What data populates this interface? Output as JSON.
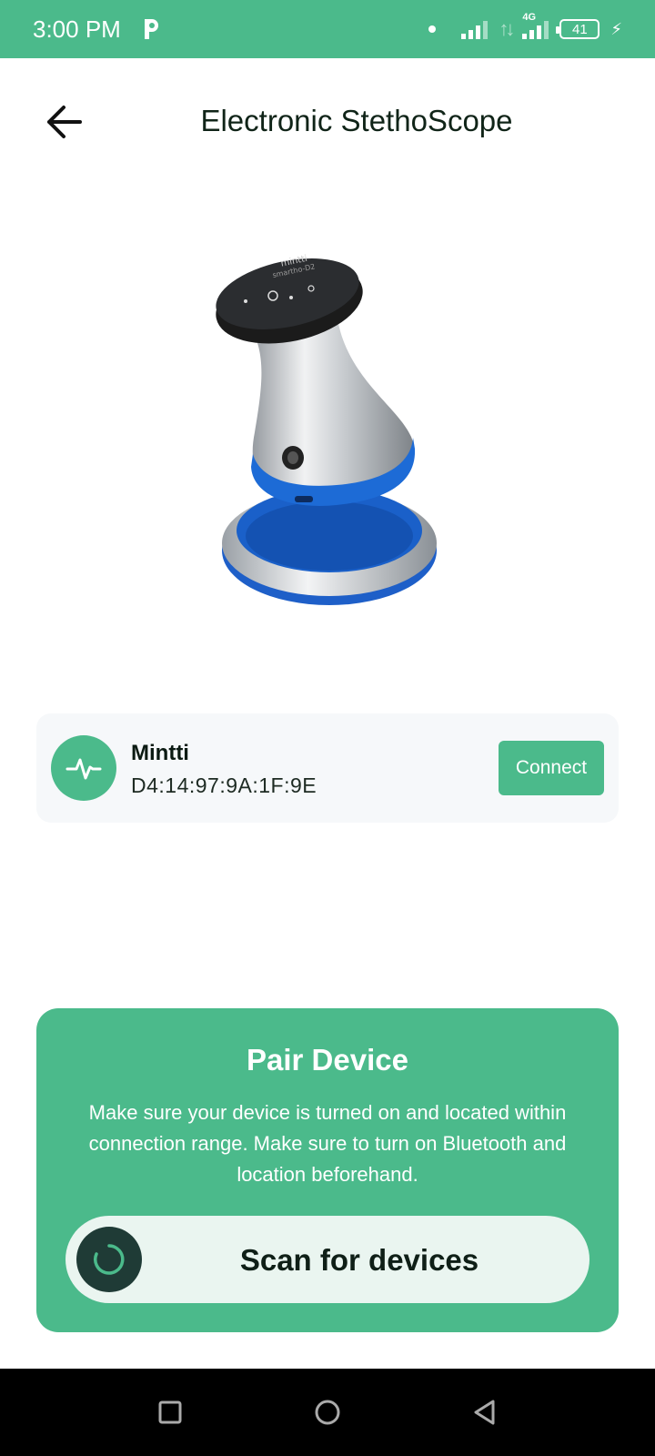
{
  "status_bar": {
    "time": "3:00 PM",
    "network_label": "4G",
    "battery": "41",
    "icons": [
      "app-p-icon",
      "dot-icon",
      "signal-icon",
      "data-arrows-icon",
      "signal-icon",
      "battery-icon",
      "charging-icon"
    ]
  },
  "header": {
    "title": "Electronic StethoScope",
    "back_icon": "arrow-left-icon"
  },
  "device_image": {
    "brand_text": "mintti",
    "model_text": "smartho-D2"
  },
  "device": {
    "name": "Mintti",
    "mac": "D4:14:97:9A:1F:9E",
    "icon": "pulse-icon",
    "connect_label": "Connect"
  },
  "pair": {
    "title": "Pair Device",
    "description": "Make sure your device is turned on and located within connection range. Make sure to turn on Bluetooth and location beforehand.",
    "scan_label": "Scan for devices",
    "scan_icon": "spinner-icon"
  },
  "navigation": {
    "icons": [
      "recents-square-icon",
      "home-circle-icon",
      "back-triangle-icon"
    ]
  },
  "colors": {
    "brand_green": "#4bba8b",
    "card_bg": "#f6f8fa",
    "scan_button_bg": "#eaf5f0",
    "scan_icon_bg": "#1f3b36"
  }
}
